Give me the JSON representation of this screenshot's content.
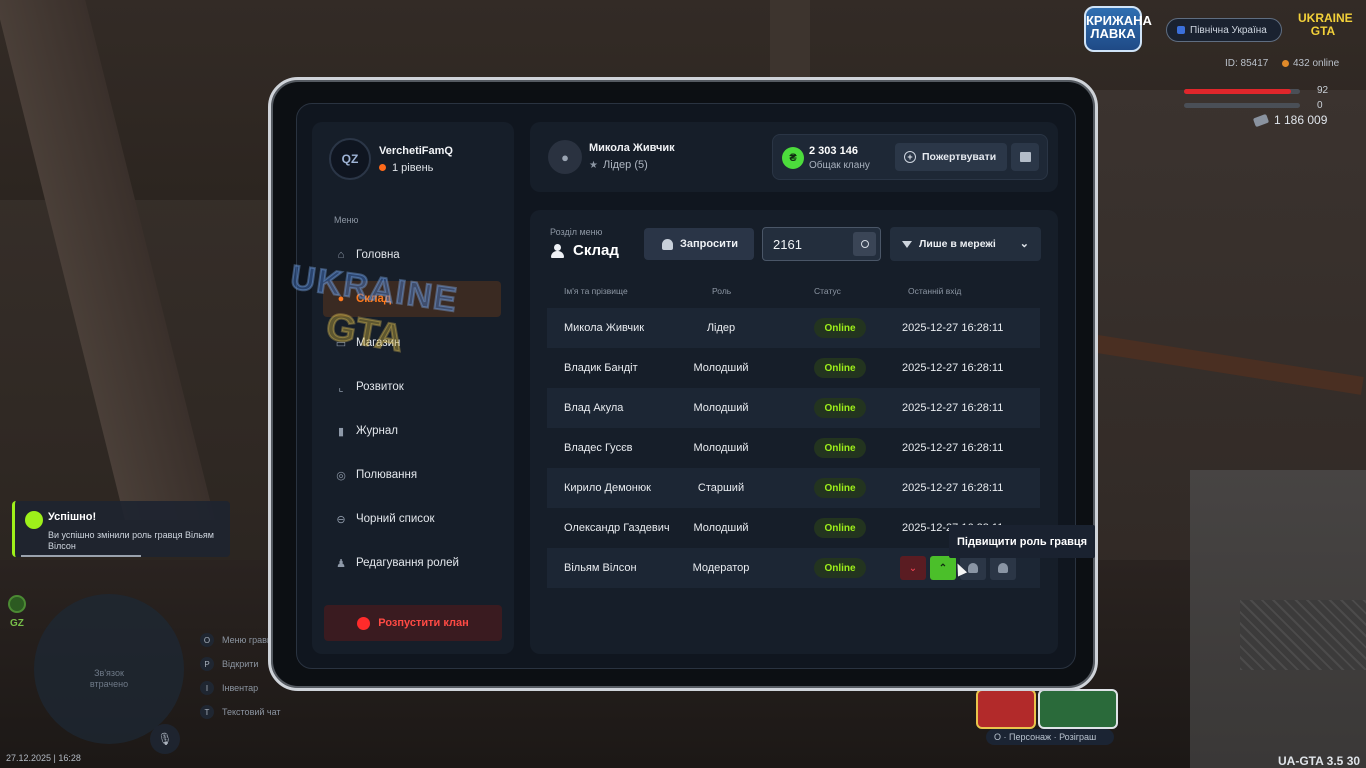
{
  "hud": {
    "logo_text": "КРИЖАНА ЛАВКА",
    "server_name": "Північна Україна",
    "gta_logo": "UKRAINE GTA",
    "player_id": "ID: 85417",
    "online": "432 online",
    "hp": "92",
    "armor": "0",
    "money": "1 186 009",
    "datetime": "27.12.2025 | 16:28",
    "version": "UA-GTA 3.5",
    "version_extra": "30",
    "gz": "GZ",
    "radar_text": "Зв'язок втрачено",
    "hotkeys": [
      {
        "key": "O",
        "label": "Меню гравця"
      },
      {
        "key": "P",
        "label": "Відкрити"
      },
      {
        "key": "I",
        "label": "Інвентар"
      },
      {
        "key": "T",
        "label": "Текстовий чат"
      }
    ],
    "xmas_label": "O · Персонаж · Розіграш",
    "hp_color": "#e0262b"
  },
  "toast": {
    "title": "Успішно!",
    "message": "Ви успішно змінили роль гравця Вільям Вілсон"
  },
  "sidebar": {
    "profile_name": "VerchetiFamQ",
    "profile_level": "1 рівень",
    "menu_caption": "Меню",
    "items": [
      {
        "label": "Головна",
        "icon": "home-icon",
        "glyph": "⌂"
      },
      {
        "label": "Склад",
        "icon": "people-icon",
        "glyph": "●"
      },
      {
        "label": "Магазин",
        "icon": "basket-icon",
        "glyph": "▭"
      },
      {
        "label": "Розвиток",
        "icon": "chart-icon",
        "glyph": "⌞"
      },
      {
        "label": "Журнал",
        "icon": "book-icon",
        "glyph": "▮"
      },
      {
        "label": "Полювання",
        "icon": "target-icon",
        "glyph": "◎"
      },
      {
        "label": "Чорний список",
        "icon": "block-icon",
        "glyph": "⊖"
      },
      {
        "label": "Редагування ролей",
        "icon": "user-edit-icon",
        "glyph": "♟"
      }
    ],
    "active_index": 1,
    "dissolve_label": "Розпустити клан"
  },
  "header": {
    "leader_name": "Микола Живчик",
    "leader_role": "Лідер (5)",
    "bank_amount": "2 303 146",
    "bank_label": "Общак клану",
    "donate_label": "Пожертвувати"
  },
  "panel": {
    "section_caption": "Розділ меню",
    "section_title": "Склад",
    "invite_label": "Запросити",
    "search_value": "2161",
    "filter_label": "Лише в мережі",
    "columns": {
      "name": "Ім'я та прізвище",
      "role": "Роль",
      "status": "Статус",
      "last": "Останній вхід"
    },
    "members": [
      {
        "name": "Микола Живчик",
        "role": "Лідер",
        "status": "Online",
        "last": "2025-12-27 16:28:11"
      },
      {
        "name": "Владик Бандіт",
        "role": "Молодший",
        "status": "Online",
        "last": "2025-12-27 16:28:11"
      },
      {
        "name": "Влад Акула",
        "role": "Молодший",
        "status": "Online",
        "last": "2025-12-27 16:28:11"
      },
      {
        "name": "Владес Гусєв",
        "role": "Молодший",
        "status": "Online",
        "last": "2025-12-27 16:28:11"
      },
      {
        "name": "Кирило Демонюк",
        "role": "Старший",
        "status": "Online",
        "last": "2025-12-27 16:28:11"
      },
      {
        "name": "Олександр Газдевич",
        "role": "Молодший",
        "status": "Online",
        "last": "2025-12-27 16:28:11"
      },
      {
        "name": "Вільям Вілсон",
        "role": "Модератор",
        "status": "Online",
        "last": ""
      }
    ],
    "watermark_line1": "UKRAINE",
    "watermark_line2": "GTA"
  },
  "tooltip": "Підвищити роль гравця",
  "colors": {
    "accent": "#ff7a1e",
    "online": "#9ef01a",
    "danger": "#ff4a44"
  }
}
